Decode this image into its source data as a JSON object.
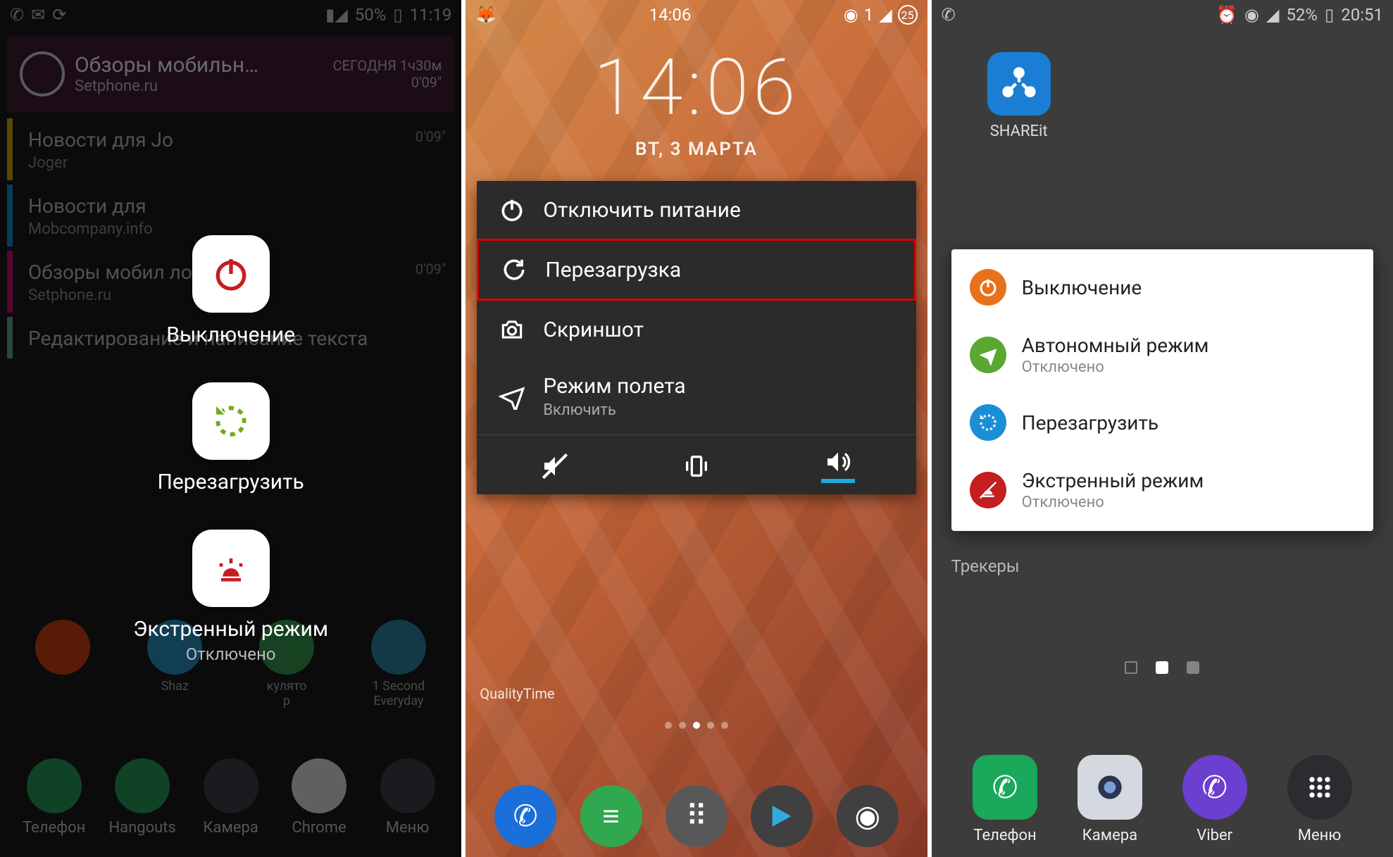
{
  "phone1": {
    "statusbar": {
      "battery": "50%",
      "time": "11:19"
    },
    "widget": {
      "title": "Обзоры мобильн…",
      "subtitle": "Setphone.ru",
      "today_label": "СЕГОДНЯ",
      "today_value": "1ч30м",
      "counter": "0'09\""
    },
    "notifs": [
      {
        "title": "Новости для Jo",
        "sub": "Joger",
        "time": "0'09\""
      },
      {
        "title": "Новости для",
        "sub": "Mobcompany.info",
        "time": ""
      },
      {
        "title": "Обзоры мобил            ложений",
        "sub": "Setphone.ru",
        "time": "0'09\""
      },
      {
        "title": "Редактирование и написание текста",
        "sub": "",
        "time": ""
      }
    ],
    "apps": [
      {
        "label": "",
        "color": "#e53900"
      },
      {
        "label": "Shaz",
        "color": "#1a9ed8"
      },
      {
        "label": "кулято\nр",
        "color": "#2fa84f"
      },
      {
        "label": "1 Second\nEveryday",
        "color": "#1f8fb0"
      }
    ],
    "dock": [
      {
        "label": "Телефон",
        "color": "#1aa85a"
      },
      {
        "label": "Hangouts",
        "color": "#1aa85a"
      },
      {
        "label": "Камера",
        "color": "#3a3a46"
      },
      {
        "label": "Chrome",
        "color": "#ffffff"
      },
      {
        "label": "Меню",
        "color": "#3a3a46"
      }
    ],
    "power": [
      {
        "icon": "power",
        "label": "Выключение",
        "sub": "",
        "color": "#c41e1e"
      },
      {
        "icon": "restart",
        "label": "Перезагрузить",
        "sub": "",
        "color": "#6faa1e"
      },
      {
        "icon": "emergency",
        "label": "Экстренный режим",
        "sub": "Отключено",
        "color": "#c41e1e"
      }
    ]
  },
  "phone2": {
    "statusbar": {
      "time": "14:06",
      "sim": "1",
      "badge": "25"
    },
    "clock": "14:06",
    "date": "ВТ, 3 МАРТА",
    "menu": [
      {
        "icon": "power",
        "label": "Отключить питание",
        "sub": "",
        "highlight": false
      },
      {
        "icon": "restart",
        "label": "Перезагрузка",
        "sub": "",
        "highlight": true
      },
      {
        "icon": "camera",
        "label": "Скриншот",
        "sub": "",
        "highlight": false
      },
      {
        "icon": "airplane",
        "label": "Режим полета",
        "sub": "Включить",
        "highlight": false
      }
    ],
    "quality_label": "QualityTime",
    "dock_colors": [
      "#1a6fd8",
      "#2fa84f",
      "#555",
      "#555",
      "#555"
    ]
  },
  "phone3": {
    "statusbar": {
      "battery": "52%",
      "time": "20:51"
    },
    "shareit": {
      "label": "SHAREit"
    },
    "popup": [
      {
        "icon": "power",
        "color": "#e8711a",
        "title": "Выключение",
        "sub": ""
      },
      {
        "icon": "airplane",
        "color": "#5aa82f",
        "title": "Автономный режим",
        "sub": "Отключено"
      },
      {
        "icon": "restart",
        "color": "#1a8fd8",
        "title": "Перезагрузить",
        "sub": ""
      },
      {
        "icon": "emergency",
        "color": "#c41e1e",
        "title": "Экстренный режим",
        "sub": "Отключено"
      }
    ],
    "trackers_label": "Трекеры",
    "dock": [
      {
        "label": "Телефон",
        "color": "#1aa85a"
      },
      {
        "label": "Камера",
        "color": "#3a4050"
      },
      {
        "label": "Viber",
        "color": "#6b3fcf"
      },
      {
        "label": "Меню",
        "color": "#2b2b30"
      }
    ]
  }
}
